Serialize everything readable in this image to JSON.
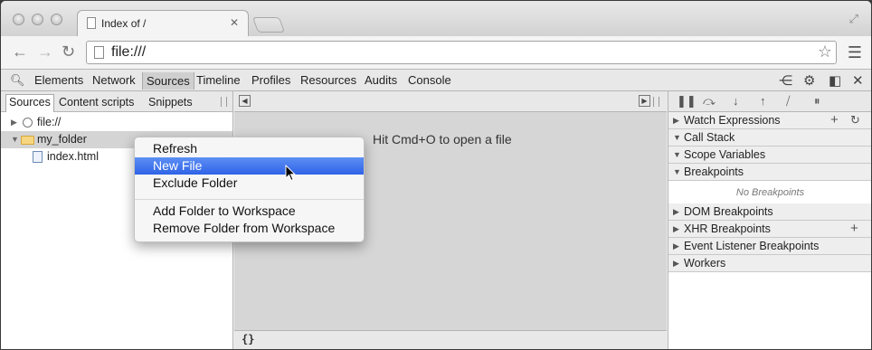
{
  "browser": {
    "tab_title": "Index of /",
    "tab_close": "✕",
    "url": "file:///",
    "back_icon": "back-arrow-icon",
    "forward_icon": "forward-arrow-icon",
    "reload_icon": "reload-icon"
  },
  "devtools": {
    "tabs": [
      "Elements",
      "Network",
      "Sources",
      "Timeline",
      "Profiles",
      "Resources",
      "Audits",
      "Console"
    ],
    "active_tab": "Sources"
  },
  "navigator": {
    "tabs": [
      "Sources",
      "Content scripts",
      "Snippets"
    ],
    "tree": [
      {
        "label": "file://",
        "icon": "globe-icon",
        "expanded": false
      },
      {
        "label": "my_folder",
        "icon": "folder-icon",
        "expanded": true
      },
      {
        "label": "index.html",
        "icon": "file-icon"
      }
    ]
  },
  "editor": {
    "empty_message": "Hit Cmd+O to open a file",
    "pretty_print": "{}"
  },
  "context_menu": {
    "items": [
      "Refresh",
      "New File",
      "Exclude Folder",
      "Add Folder to Workspace",
      "Remove Folder from Workspace"
    ],
    "highlighted": "New File"
  },
  "sidebar": {
    "sections": [
      "Watch Expressions",
      "Call Stack",
      "Scope Variables",
      "Breakpoints",
      "DOM Breakpoints",
      "XHR Breakpoints",
      "Event Listener Breakpoints",
      "Workers"
    ],
    "no_breakpoints": "No Breakpoints"
  },
  "colors": {
    "highlight": "#3a6ef0",
    "folder": "#f6d680"
  }
}
